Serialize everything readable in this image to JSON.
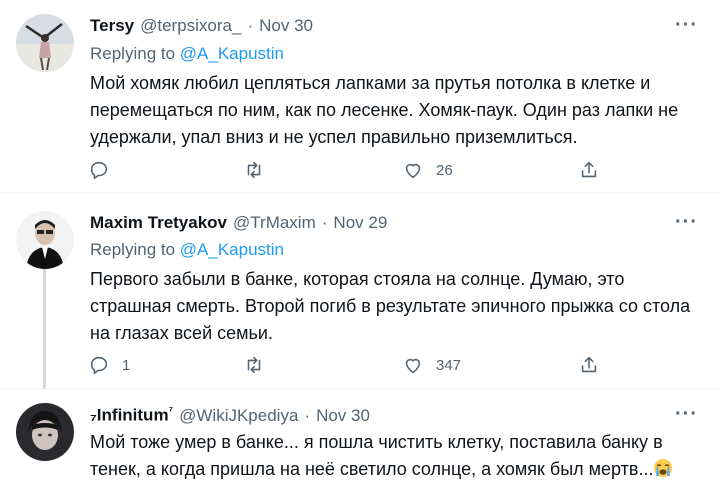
{
  "tweets": [
    {
      "name": "Tersy",
      "handle": "@terpsixora_",
      "separator": "·",
      "date": "Nov 30",
      "replying_prefix": "Replying to",
      "replying_to": "@A_Kapustin",
      "text": "Мой хомяк любил цепляться лапками за прутья потолка в клетке и перемещаться по ним, как по лесенке. Хомяк-паук. Один раз лапки не удержали, упал вниз и не успел правильно приземлиться.",
      "reply_count": "",
      "retweet_count": "",
      "like_count": "26",
      "more_label": "···"
    },
    {
      "name": "Maxim Tretyakov",
      "handle": "@TrMaxim",
      "separator": "·",
      "date": "Nov 29",
      "replying_prefix": "Replying to",
      "replying_to": "@A_Kapustin",
      "text": "Первого забыли в банке, которая стояла на солнце. Думаю, это страшная смерть. Второй погиб в результате эпичного прыжка со стола на глазах всей семьи.",
      "reply_count": "1",
      "retweet_count": "",
      "like_count": "347",
      "more_label": "···"
    },
    {
      "name": "₇Infinitum",
      "name_sup": "⁷",
      "handle": "@WikiJKpediya",
      "separator": "·",
      "date": "Nov 30",
      "text": "Мой тоже умер в банке... я пошла чистить клетку, поставила банку в тенек, а когда пришла на неё светило солнце, а хомяк был мертв...",
      "emoji": "loudly-crying-face",
      "more_label": "···"
    }
  ],
  "colors": {
    "accent": "#1d9bf0",
    "secondary_text": "#536471",
    "primary_text": "#0f1419",
    "divider": "#eff3f4",
    "thread_line": "#cfd9de"
  },
  "icons": [
    "reply-icon",
    "retweet-icon",
    "like-icon",
    "share-icon",
    "more-icon"
  ]
}
